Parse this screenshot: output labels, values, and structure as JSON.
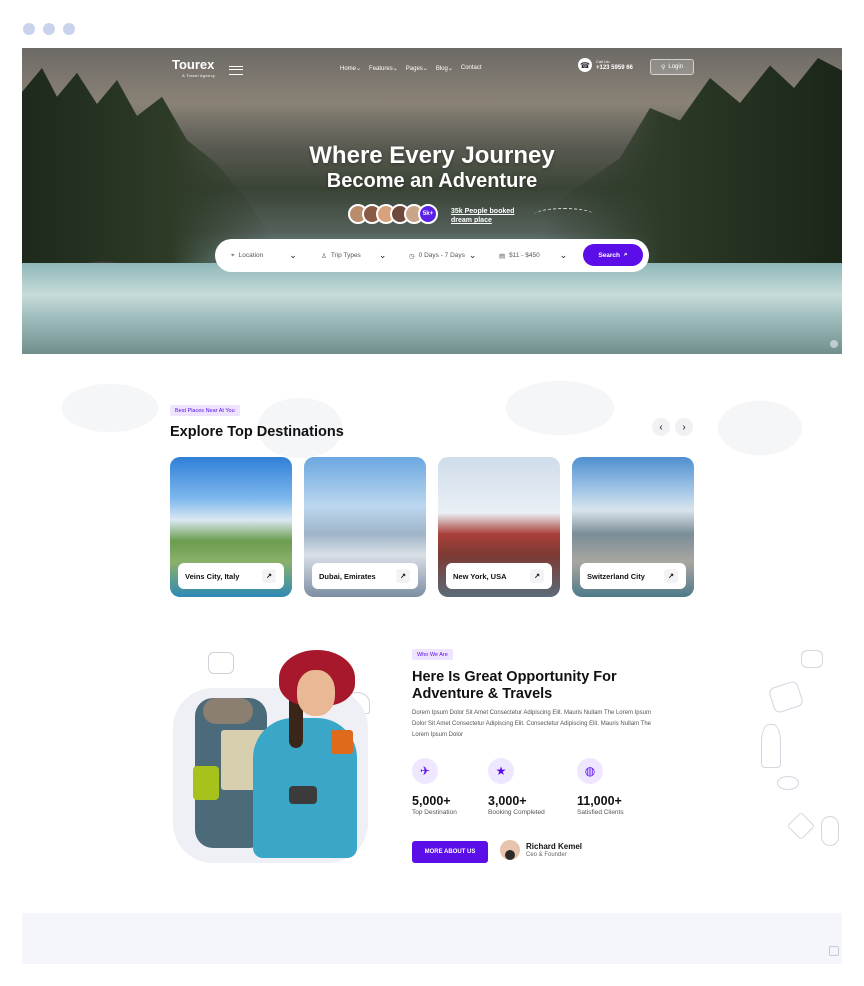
{
  "brand": {
    "name": "Tourex",
    "tagline": "A Travel Agency"
  },
  "nav": {
    "menu": [
      "Home",
      "Features",
      "Pages",
      "Blog",
      "Contact"
    ],
    "dropdown_marker": "⌄",
    "call_label": "Call Us:",
    "phone": "+123 5959 66",
    "login": "Login"
  },
  "hero": {
    "title_line1": "Where Every Journey",
    "title_line2": "Become an Adventure",
    "avatar_count_badge": "5k+",
    "booked_line1": "35k People booked",
    "booked_line2": "dream place"
  },
  "search": {
    "location": "Location",
    "trip_types": "Trip Types",
    "duration": "0 Days - 7 Days",
    "price": "$11 - $450",
    "button": "Search"
  },
  "destinations": {
    "tag": "Best Places Near At You",
    "title": "Explore Top Destinations",
    "prev": "‹",
    "next": "›",
    "cards": [
      {
        "name": "Veins City, Italy"
      },
      {
        "name": "Dubai, Emirates"
      },
      {
        "name": "New York, USA"
      },
      {
        "name": "Switzerland City"
      }
    ],
    "card_arrow": "↗"
  },
  "about": {
    "tag": "Who We Are",
    "title_line1": "Here Is Great Opportunity For",
    "title_line2": "Adventure & Travels",
    "paragraph": "Dorem Ipsum Dolor Sit Amet Consectetur Adipiscing Elit. Mauris Nullam The Lorem Ipsum Dolor Sit Amet Consectetur Adipiscing Elit. Consectetur Adipiscing Elit. Mauris Nullam The Lorem Ipsum Dolor",
    "stats": [
      {
        "value": "5,000+",
        "label": "Top Destination",
        "icon": "ticket-icon"
      },
      {
        "value": "3,000+",
        "label": "Booking Completed",
        "icon": "people-stars-icon"
      },
      {
        "value": "11,000+",
        "label": "Satisfied Clients",
        "icon": "globe-pin-icon"
      }
    ],
    "button": "MORE ABOUT US",
    "ceo_name": "Richard Kemel",
    "ceo_role": "Ceo & Founder"
  },
  "colors": {
    "accent": "#5b0ee8",
    "tag_bg": "#eee4ff",
    "dots": "#c9d3ee"
  }
}
